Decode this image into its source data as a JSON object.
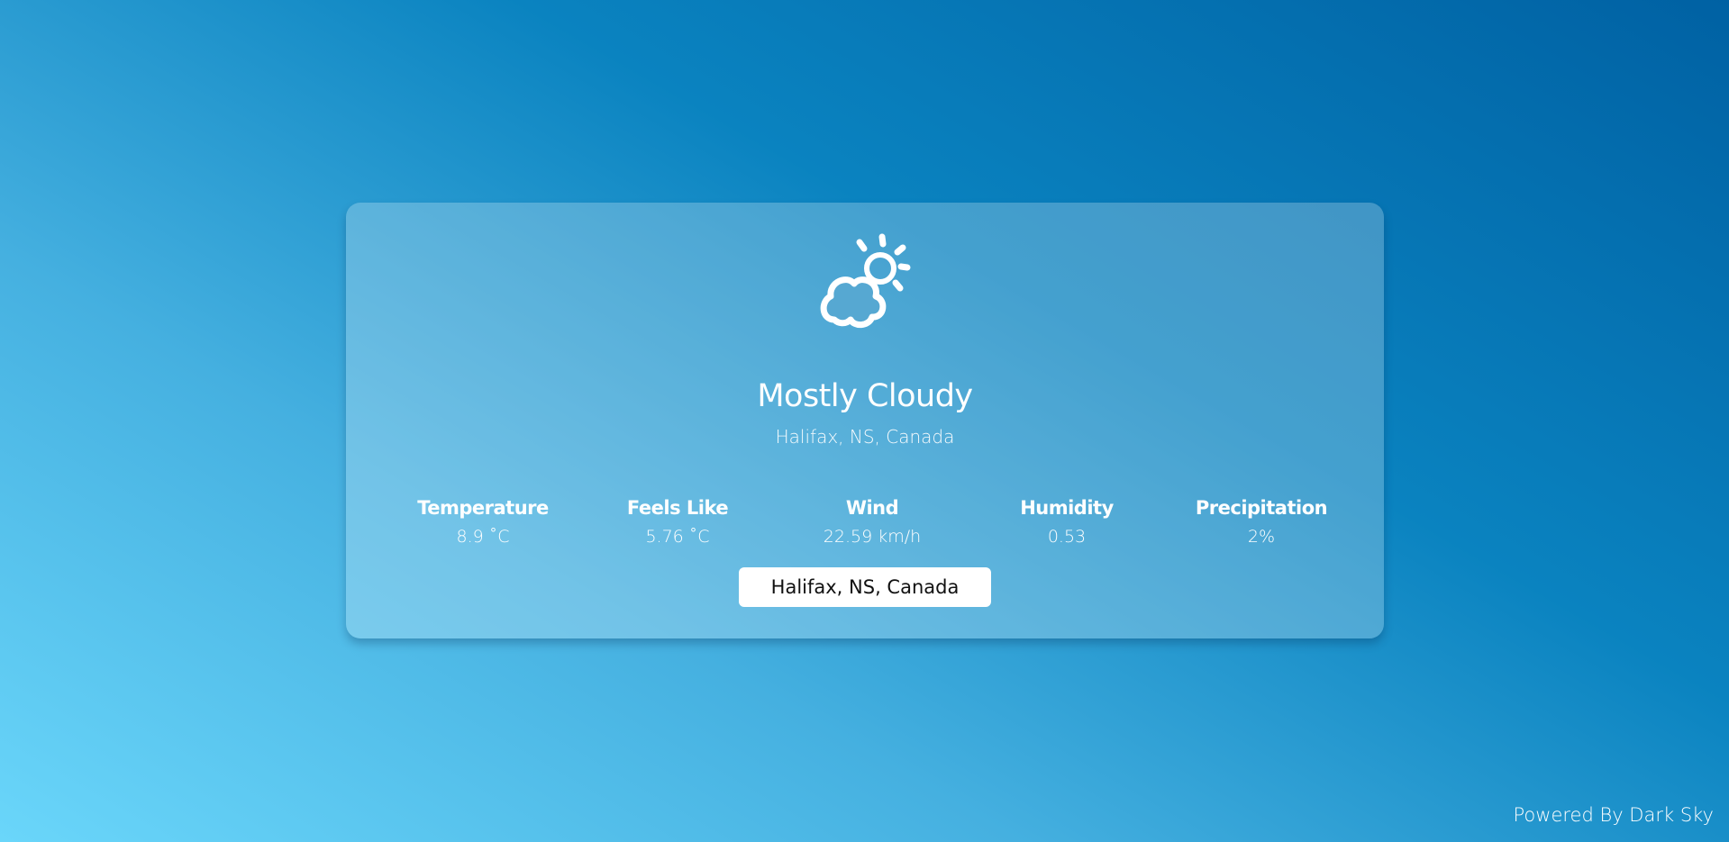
{
  "weather": {
    "icon": "partly-cloudy-day-icon",
    "condition": "Mostly Cloudy",
    "location": "Halifax, NS, Canada"
  },
  "stats": [
    {
      "label": "Temperature",
      "value": "8.9 ˚C"
    },
    {
      "label": "Feels Like",
      "value": "5.76 ˚C"
    },
    {
      "label": "Wind",
      "value": "22.59 km/h"
    },
    {
      "label": "Humidity",
      "value": "0.53"
    },
    {
      "label": "Precipitation",
      "value": "2%"
    }
  ],
  "search": {
    "value": "Halifax, NS, Canada"
  },
  "footer": {
    "attribution": "Powered By Dark Sky"
  },
  "colors": {
    "background_start": "#6ad6fa",
    "background_end": "#0061a3",
    "text": "#ffffff",
    "input_background": "#ffffff",
    "input_text": "#111111"
  }
}
